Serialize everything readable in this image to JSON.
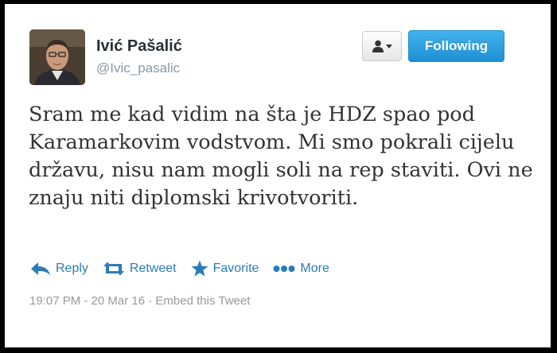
{
  "user": {
    "display_name": "Ivić Pašalić",
    "handle": "@Ivic_pasalic"
  },
  "buttons": {
    "user_menu_icon": "user-dropdown-icon",
    "follow_label": "Following"
  },
  "tweet": {
    "text": "Sram me kad vidim na šta je HDZ spao pod Karamarkovim vodstvom. Mi smo pokrali cijelu državu, nisu nam mogli soli na rep staviti. Ovi ne znaju niti diplomski krivotvoriti."
  },
  "actions": [
    {
      "label": "Reply",
      "icon": "reply-icon"
    },
    {
      "label": "Retweet",
      "icon": "retweet-icon"
    },
    {
      "label": "Favorite",
      "icon": "star-icon"
    },
    {
      "label": "More",
      "icon": "more-dots-icon"
    }
  ],
  "meta": {
    "timestamp": "19:07 PM - 20 Mar 16",
    "separator": " · ",
    "embed_label": "Embed this Tweet"
  },
  "colors": {
    "accent": "#2b7bb9",
    "follow_button": "#2a9ae0",
    "text": "#333333",
    "muted": "#999999"
  }
}
